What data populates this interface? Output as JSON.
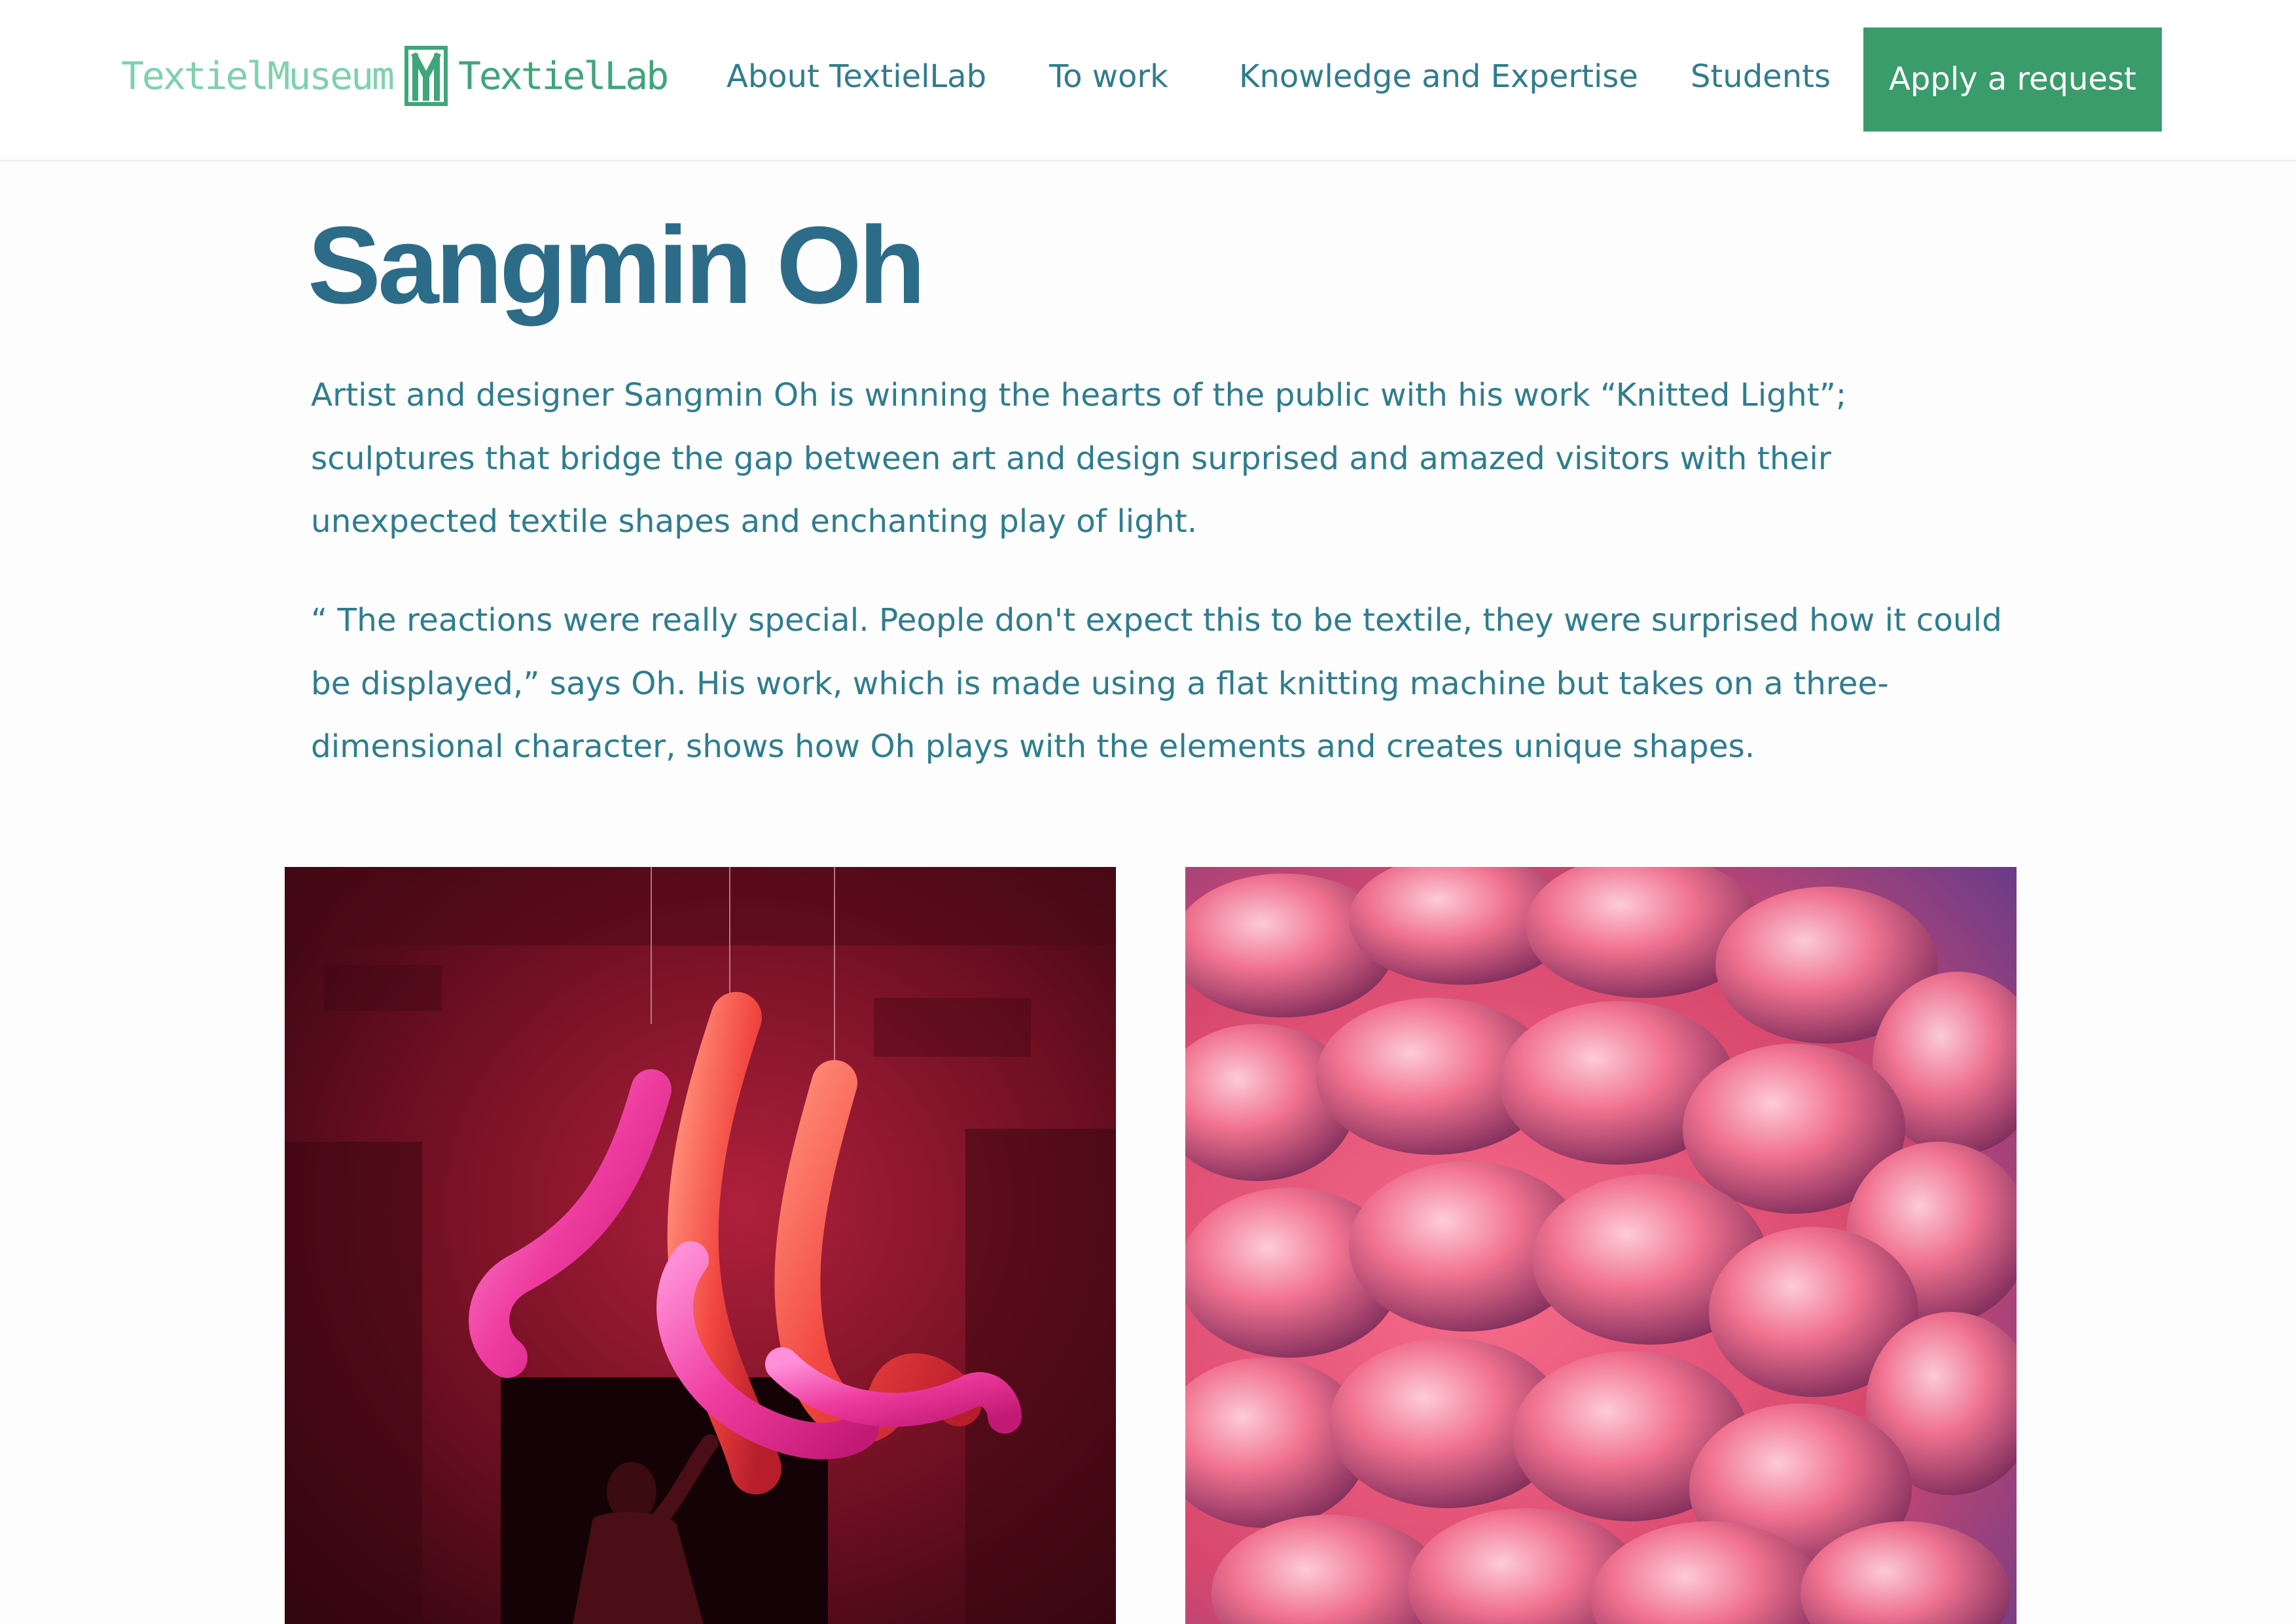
{
  "header": {
    "logo": {
      "museum": "TextielMuseum",
      "lab": "TextielLab"
    },
    "nav": {
      "about": "About TextielLab",
      "work": "To work",
      "knowledge": "Knowledge and Expertise",
      "students": "Students"
    },
    "cta": "Apply a request"
  },
  "article": {
    "title": "Sangmin Oh",
    "paragraph1": [
      "Artist and designer Sangmin Oh is winning the hearts of the public with his work  “Knitted Light”;",
      "sculptures that bridge the gap between art and design surprised and amazed visitors with their",
      "unexpected textile shapes and enchanting play of light."
    ],
    "paragraph2": [
      "“ The reactions were really special. People don't expect this to be textile, they were surprised how it could",
      "be displayed,” says Oh. His work, which is made using a flat knitting machine but takes on a three-",
      "dimensional character, shows how Oh plays with the elements and creates unique shapes."
    ]
  },
  "colors": {
    "brand_green": "#3a9b6b",
    "logo_light_green": "#7fd1ad",
    "title_blue": "#2d6c88",
    "text_teal": "#2e7d8f"
  },
  "icons": {
    "logo_mark": "textielmuseum-m-logo-icon"
  }
}
